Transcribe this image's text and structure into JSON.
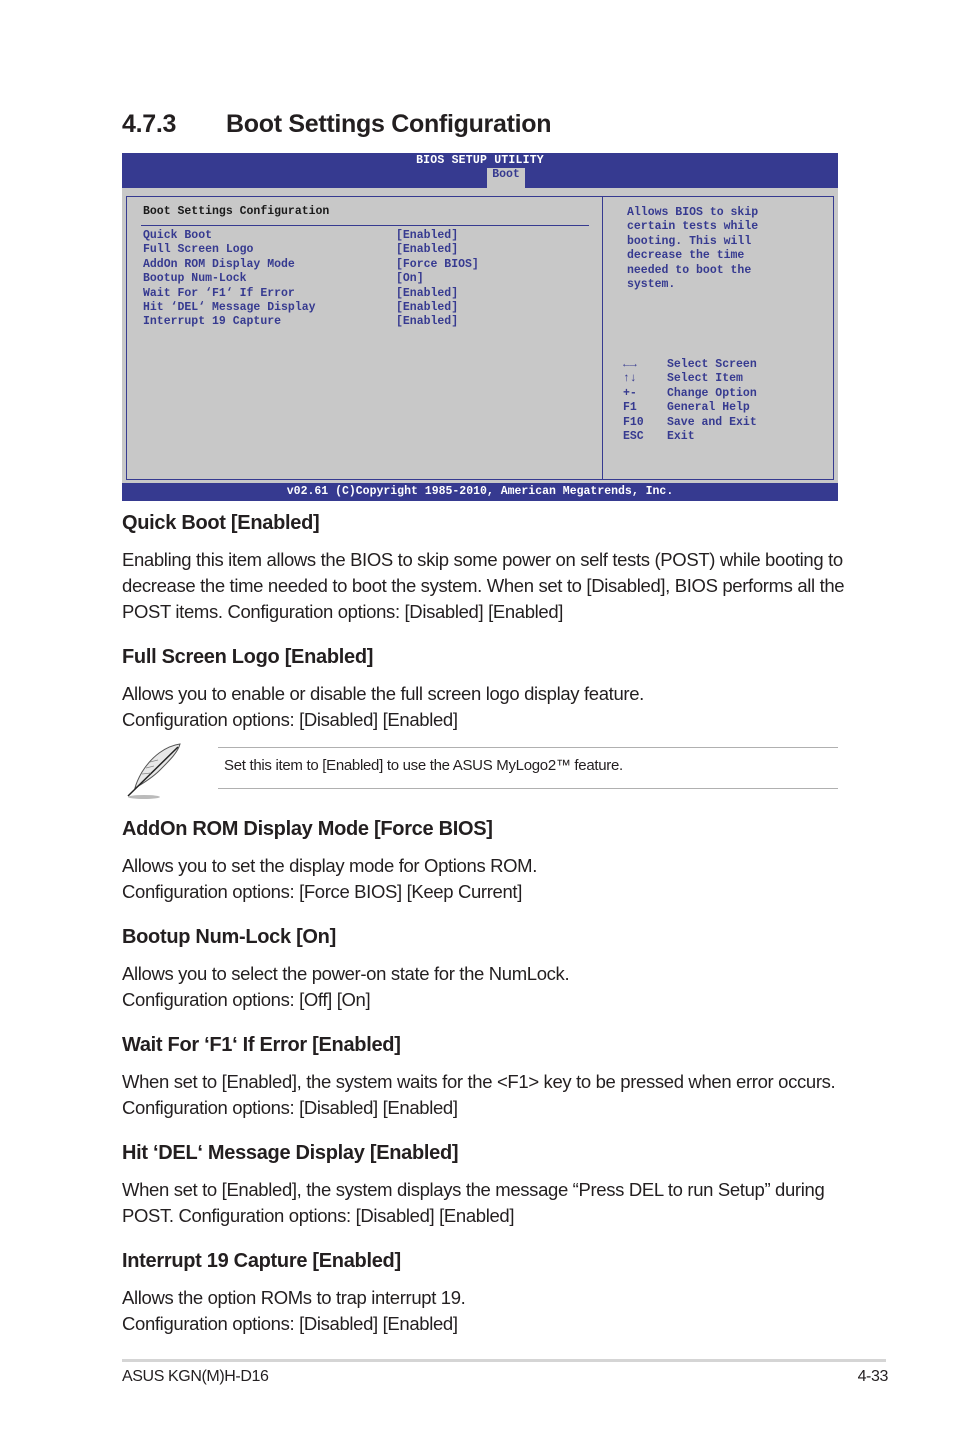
{
  "section": {
    "number": "4.7.3",
    "title": "Boot Settings Configuration"
  },
  "bios": {
    "title": "BIOS SETUP UTILITY",
    "active_tab": "Boot",
    "section_label": "Boot Settings Configuration",
    "items": [
      {
        "label": "Quick Boot",
        "value": "[Enabled]"
      },
      {
        "label": "Full Screen Logo",
        "value": "[Enabled]"
      },
      {
        "label": "AddOn ROM Display Mode",
        "value": "[Force BIOS]"
      },
      {
        "label": "Bootup Num-Lock",
        "value": "[On]"
      },
      {
        "label": "Wait For ‘F1‘ If Error",
        "value": "[Enabled]"
      },
      {
        "label": "Hit ‘DEL‘ Message Display",
        "value": "[Enabled]"
      },
      {
        "label": "Interrupt 19 Capture",
        "value": "[Enabled]"
      }
    ],
    "help_text": "Allows BIOS to skip\ncertain tests while\nbooting. This will\ndecrease the time\nneeded to boot the\nsystem.",
    "keys": [
      {
        "key": "←→",
        "action": "Select Screen"
      },
      {
        "key": "↑↓",
        "action": "Select Item"
      },
      {
        "key": "+-",
        "action": "Change Option"
      },
      {
        "key": "F1",
        "action": "General Help"
      },
      {
        "key": "F10",
        "action": "Save and Exit"
      },
      {
        "key": "ESC",
        "action": "Exit"
      }
    ],
    "footer": "v02.61 (C)Copyright 1985-2010, American Megatrends, Inc.",
    "colors": {
      "bar": "#363a90",
      "panel": "#c8c8c8",
      "text": "#363a90"
    }
  },
  "descriptions": [
    {
      "heading": "Quick Boot [Enabled]",
      "text": "Enabling this item allows the BIOS to skip some power on self tests (POST) while booting to decrease the time needed to boot the system. When set to [Disabled], BIOS performs all the POST items. Configuration options: [Disabled] [Enabled]"
    },
    {
      "heading": "Full Screen Logo [Enabled]",
      "text": "Allows you to enable or disable the full screen logo display feature.\nConfiguration options: [Disabled] [Enabled]"
    },
    {
      "heading": "AddOn ROM Display Mode [Force BIOS]",
      "text": "Allows you to set the display mode for Options ROM.\nConfiguration options: [Force BIOS] [Keep Current]"
    },
    {
      "heading": "Bootup Num-Lock [On]",
      "text": "Allows you to select the power-on state for the NumLock.\nConfiguration options: [Off] [On]"
    },
    {
      "heading": "Wait For ‘F1‘ If Error [Enabled]",
      "text": "When set to [Enabled], the system waits for the <F1> key to be pressed when error occurs. Configuration options: [Disabled] [Enabled]"
    },
    {
      "heading": "Hit ‘DEL‘ Message Display [Enabled]",
      "text": "When set to [Enabled], the system displays the message “Press DEL to run Setup” during POST. Configuration options: [Disabled] [Enabled]"
    },
    {
      "heading": "Interrupt 19 Capture [Enabled]",
      "text": "Allows the option ROMs to trap interrupt 19.\nConfiguration options: [Disabled] [Enabled]"
    }
  ],
  "note": {
    "icon": "feather-quill-icon",
    "text": "Set this item to [Enabled] to use the ASUS MyLogo2™ feature."
  },
  "footer": {
    "product": "ASUS KGN(M)H-D16",
    "page": "4-33"
  }
}
